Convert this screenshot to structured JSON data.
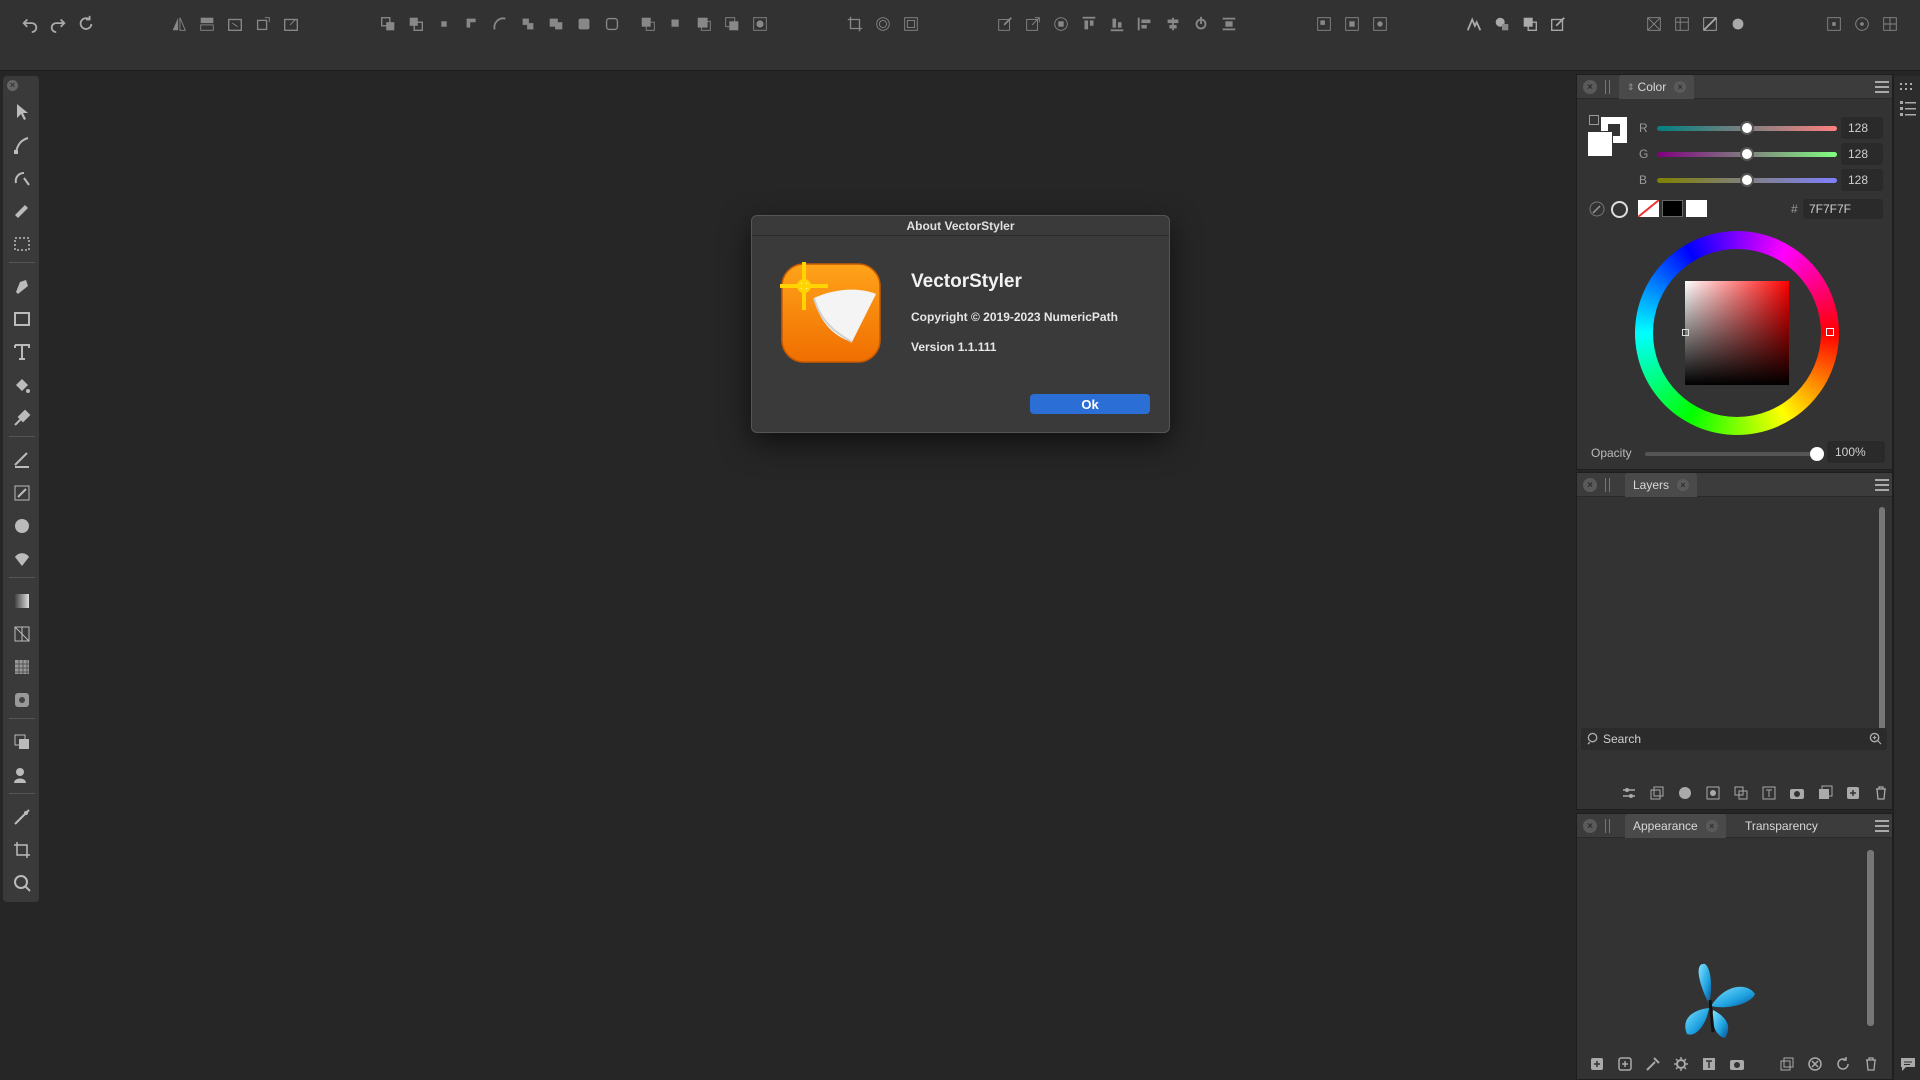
{
  "dialog": {
    "title": "About VectorStyler",
    "app_name": "VectorStyler",
    "copyright": "Copyright © 2019-2023 NumericPath",
    "version": "Version 1.1.111",
    "ok_label": "Ok"
  },
  "color_panel": {
    "tab": "Color",
    "r_label": "R",
    "r_value": "128",
    "r_fraction": 0.5,
    "g_label": "G",
    "g_value": "128",
    "g_fraction": 0.5,
    "b_label": "B",
    "b_value": "128",
    "b_fraction": 0.5,
    "hex_prefix": "#",
    "hex": "7F7F7F",
    "opacity_label": "Opacity",
    "opacity_value": "100%",
    "opacity_fraction": 1.0
  },
  "layers_panel": {
    "tab": "Layers",
    "search_placeholder": "Search"
  },
  "appearance_panel": {
    "tab_appearance": "Appearance",
    "tab_transparency": "Transparency"
  },
  "colors": {
    "accent": "#2b6fd6",
    "app_icon_orange": "#ff8a00"
  }
}
